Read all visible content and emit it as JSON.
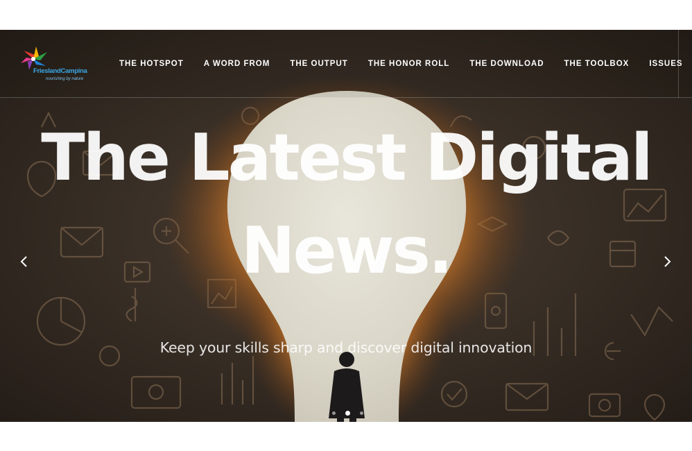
{
  "brand": {
    "name": "FrieslandCampina",
    "tagline": "nourishing by nature"
  },
  "nav": {
    "items": [
      {
        "label": "THE HOTSPOT"
      },
      {
        "label": "A WORD FROM"
      },
      {
        "label": "THE OUTPUT"
      },
      {
        "label": "THE HONOR ROLL"
      },
      {
        "label": "THE DOWNLOAD"
      },
      {
        "label": "THE TOOLBOX"
      },
      {
        "label": "ISSUES"
      }
    ]
  },
  "hero": {
    "headline_line1": "The Latest Digital",
    "headline_line2": "News.",
    "subtitle": "Keep your skills sharp and discover digital innovation"
  },
  "slider": {
    "prev_icon": "chevron-left-icon",
    "next_icon": "chevron-right-icon",
    "slide_count": 3,
    "active_slide": 2
  },
  "colors": {
    "background": "#3a3129",
    "glow": "#f5a24a",
    "bulb": "#e2ded2",
    "text": "#ffffff"
  }
}
